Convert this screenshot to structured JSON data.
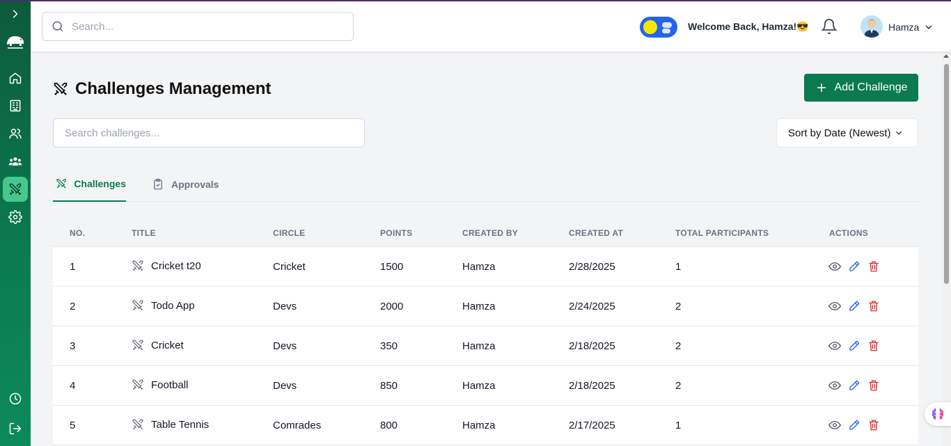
{
  "header": {
    "search_placeholder": "Search...",
    "welcome_text": "Welcome Back, Hamza!😎",
    "username": "Hamza"
  },
  "page": {
    "title": "Challenges Management",
    "add_button_label": "Add Challenge",
    "search_placeholder": "Search challenges...",
    "sort_label": "Sort by Date (Newest)"
  },
  "tabs": [
    {
      "label": "Challenges",
      "active": true
    },
    {
      "label": "Approvals",
      "active": false
    }
  ],
  "table": {
    "columns": [
      "NO.",
      "TITLE",
      "CIRCLE",
      "POINTS",
      "CREATED BY",
      "CREATED AT",
      "TOTAL PARTICIPANTS",
      "ACTIONS"
    ],
    "rows": [
      {
        "no": "1",
        "title": "Cricket t20",
        "circle": "Cricket",
        "points": "1500",
        "created_by": "Hamza",
        "created_at": "2/28/2025",
        "participants": "1"
      },
      {
        "no": "2",
        "title": "Todo App",
        "circle": "Devs",
        "points": "2000",
        "created_by": "Hamza",
        "created_at": "2/24/2025",
        "participants": "2"
      },
      {
        "no": "3",
        "title": "Cricket",
        "circle": "Devs",
        "points": "350",
        "created_by": "Hamza",
        "created_at": "2/18/2025",
        "participants": "2"
      },
      {
        "no": "4",
        "title": "Football",
        "circle": "Devs",
        "points": "850",
        "created_by": "Hamza",
        "created_at": "2/18/2025",
        "participants": "2"
      },
      {
        "no": "5",
        "title": "Table Tennis",
        "circle": "Comrades",
        "points": "800",
        "created_by": "Hamza",
        "created_at": "2/17/2025",
        "participants": "1"
      }
    ]
  },
  "colors": {
    "brand_green": "#0b7a50",
    "sidebar_active": "#46c78d",
    "edit_blue": "#2563eb",
    "delete_red": "#dc2626",
    "view_gray": "#4b5563"
  },
  "icons": {
    "sidebar": [
      "expand-icon",
      "logo-icon",
      "home-icon",
      "building-icon",
      "users-icon",
      "group-icon",
      "swords-icon",
      "gear-icon",
      "clock-icon",
      "logout-icon"
    ],
    "row_actions": [
      "eye-icon",
      "pencil-icon",
      "trash-icon"
    ]
  }
}
